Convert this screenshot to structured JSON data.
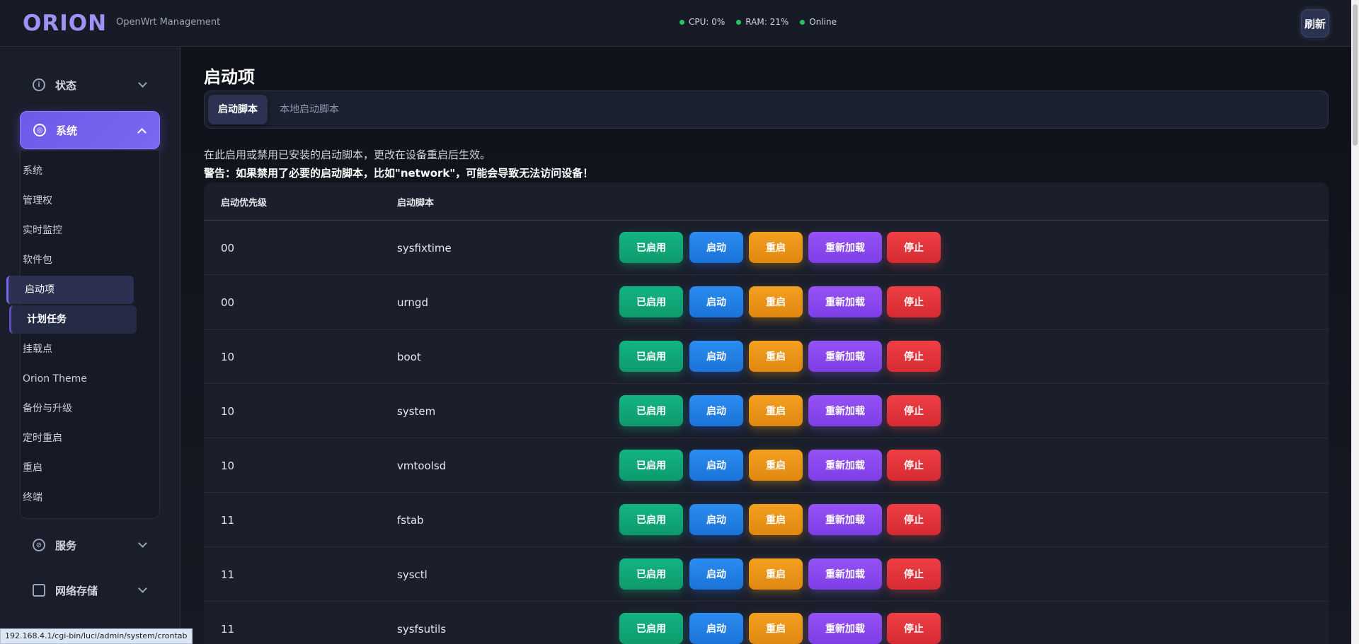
{
  "header": {
    "logo": "ORION",
    "subtitle": "OpenWrt Management",
    "cpu": "CPU: 0%",
    "ram": "RAM: 21%",
    "online": "Online",
    "refresh_label": "刷新"
  },
  "sidebar": {
    "groups": [
      {
        "label": "状态"
      },
      {
        "label": "系统"
      },
      {
        "label": "服务"
      },
      {
        "label": "网络存储"
      }
    ],
    "subitems": [
      "系统",
      "管理权",
      "实时监控",
      "软件包",
      "启动项",
      "计划任务",
      "挂载点",
      "Orion Theme",
      "备份与升级",
      "定时重启",
      "重启",
      "终端"
    ]
  },
  "main": {
    "title": "启动项",
    "tabs": [
      "启动脚本",
      "本地启动脚本"
    ],
    "desc": "在此启用或禁用已安装的启动脚本，更改在设备重启后生效。",
    "warning": "警告：如果禁用了必要的启动脚本，比如\"network\"，可能会导致无法访问设备！",
    "table": {
      "headers": [
        "启动优先级",
        "启动脚本"
      ],
      "buttons": [
        "已启用",
        "启动",
        "重启",
        "重新加载",
        "停止"
      ],
      "rows": [
        {
          "priority": "00",
          "script": "sysfixtime"
        },
        {
          "priority": "00",
          "script": "urngd"
        },
        {
          "priority": "10",
          "script": "boot"
        },
        {
          "priority": "10",
          "script": "system"
        },
        {
          "priority": "10",
          "script": "vmtoolsd"
        },
        {
          "priority": "11",
          "script": "fstab"
        },
        {
          "priority": "11",
          "script": "sysctl"
        },
        {
          "priority": "11",
          "script": "sysfsutils"
        }
      ]
    }
  },
  "status_url": "192.168.4.1/cgi-bin/luci/admin/system/crontab",
  "colors": {
    "accent": "#7b68f0",
    "enabled": "#10b981",
    "start": "#2b8cf0",
    "restart": "#f3a020",
    "reload": "#9552f5",
    "stop": "#ee3f44"
  }
}
